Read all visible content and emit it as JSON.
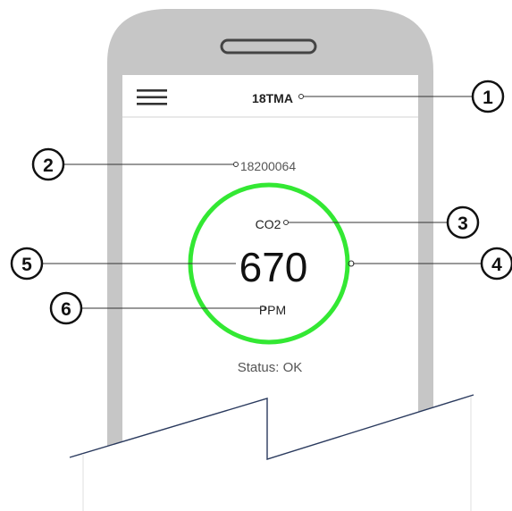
{
  "app": {
    "title": "18TMA",
    "device_id": "18200064",
    "gas": "CO2",
    "value": "670",
    "unit": "PPM",
    "status": "Status: OK"
  },
  "callouts": [
    "1",
    "2",
    "3",
    "4",
    "5",
    "6"
  ],
  "colors": {
    "ring": "#33e833",
    "phone_body": "#c6c6c6",
    "phone_screen": "#ffffff",
    "callout_stroke": "#111111"
  },
  "icons": {
    "menu": "hamburger-menu-icon"
  }
}
